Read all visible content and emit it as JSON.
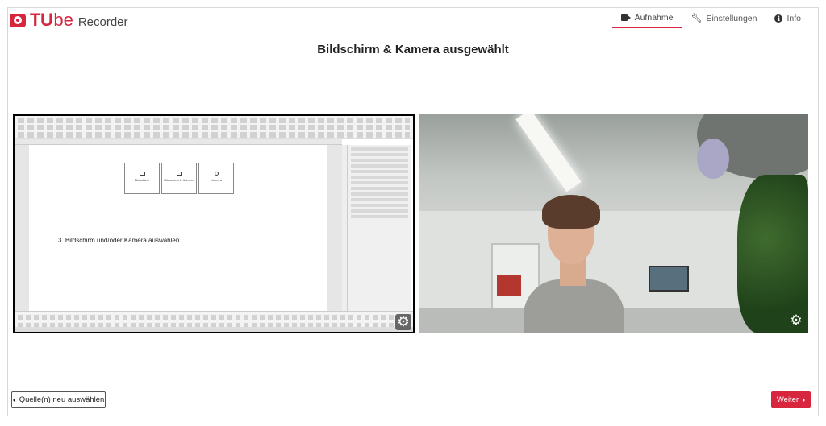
{
  "brand": {
    "tu": "TU",
    "be": "be",
    "recorder": "Recorder",
    "accent_color": "#d7263d"
  },
  "nav": {
    "items": [
      {
        "label": "Aufnahme",
        "icon": "video-camera-icon",
        "active": true
      },
      {
        "label": "Einstellungen",
        "icon": "wrench-icon",
        "active": false
      },
      {
        "label": "Info",
        "icon": "info-icon",
        "active": false
      }
    ]
  },
  "page": {
    "title": "Bildschirm & Kamera ausgewählt"
  },
  "screen_preview": {
    "doc_buttons": [
      "Bildschirm",
      "Bildschirm & Kamera",
      "Kamera"
    ],
    "doc_text": "3. Bildschirm und/oder Kamera auswählen",
    "settings_icon": "gear-icon"
  },
  "camera_preview": {
    "settings_icon": "gear-icon"
  },
  "footer": {
    "back_label": "Quelle(n) neu auswählen",
    "next_label": "Weiter"
  }
}
